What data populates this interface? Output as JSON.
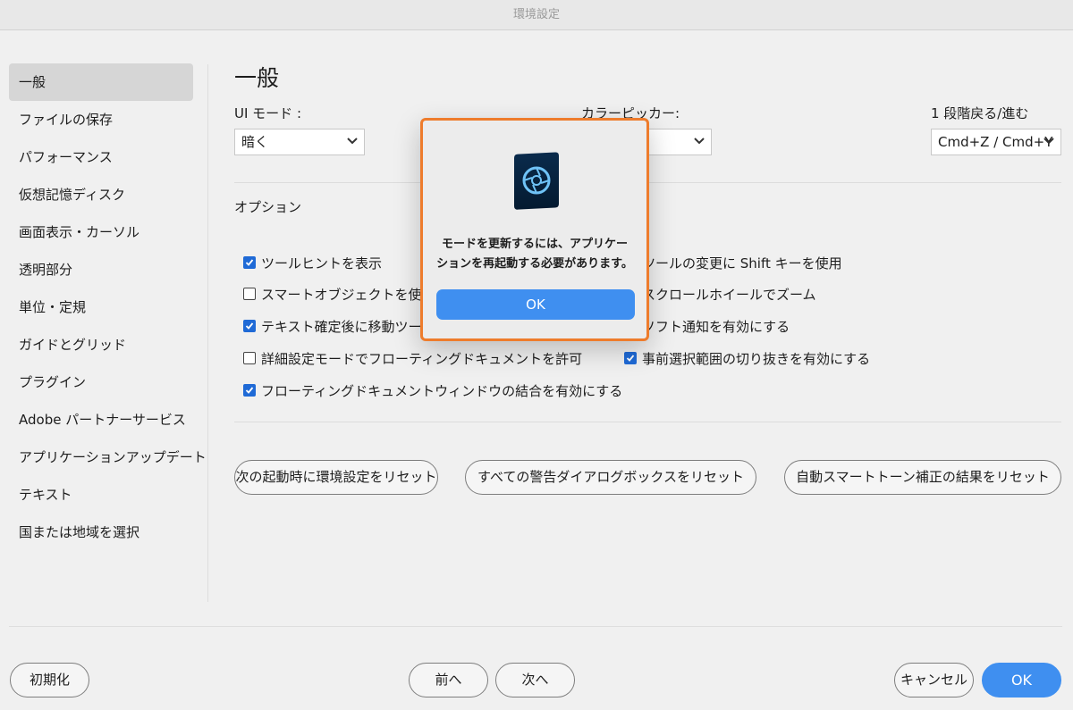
{
  "window": {
    "title": "環境設定"
  },
  "sidebar": {
    "items": [
      {
        "label": "一般"
      },
      {
        "label": "ファイルの保存"
      },
      {
        "label": "パフォーマンス"
      },
      {
        "label": "仮想記憶ディスク"
      },
      {
        "label": "画面表示・カーソル"
      },
      {
        "label": "透明部分"
      },
      {
        "label": "単位・定規"
      },
      {
        "label": "ガイドとグリッド"
      },
      {
        "label": "プラグイン"
      },
      {
        "label": "Adobe パートナーサービス"
      },
      {
        "label": "アプリケーションアップデート"
      },
      {
        "label": "テキスト"
      },
      {
        "label": "国または地域を選択"
      }
    ]
  },
  "main": {
    "title": "一般",
    "ui_mode": {
      "label": "UI モード :",
      "value": "暗く"
    },
    "color_picker": {
      "label": "カラーピッカー:",
      "value": ""
    },
    "undo": {
      "label": "1 段階戻る/進む",
      "value": "Cmd+Z / Cmd+Y"
    },
    "options_title": "オプション",
    "options_left": [
      {
        "label": "ツールヒントを表示",
        "checked": true
      },
      {
        "label": "スマートオブジェクトを使用",
        "checked": false
      },
      {
        "label": "テキスト確定後に移動ツール",
        "checked": true
      },
      {
        "label": "詳細設定モードでフローティングドキュメントを許可",
        "checked": false
      },
      {
        "label": "フローティングドキュメントウィンドウの結合を有効にする",
        "checked": true
      }
    ],
    "options_right": [
      {
        "label": "ツールの変更に Shift キーを使用",
        "checked": true
      },
      {
        "label": "スクロールホイールでズーム",
        "checked": false
      },
      {
        "label": "ソフト通知を有効にする",
        "checked": true
      },
      {
        "label": "事前選択範囲の切り抜きを有効にする",
        "checked": true
      }
    ],
    "reset_buttons": [
      {
        "label": "次の起動時に環境設定をリセット"
      },
      {
        "label": "すべての警告ダイアログボックスをリセット"
      },
      {
        "label": "自動スマートトーン補正の結果をリセット"
      }
    ]
  },
  "footer": {
    "reset_label": "初期化",
    "prev_label": "前へ",
    "next_label": "次へ",
    "cancel_label": "キャンセル",
    "ok_label": "OK"
  },
  "dialog": {
    "icon": "photoshop-elements-icon",
    "message_line1": "モードを更新するには、アプリケー",
    "message_line2": "ションを再起動する必要があります。",
    "ok_label": "OK"
  },
  "colors": {
    "accent": "#3f8ff0",
    "checkbox": "#1f6ad6",
    "dialog_highlight": "#ee7c2c"
  }
}
